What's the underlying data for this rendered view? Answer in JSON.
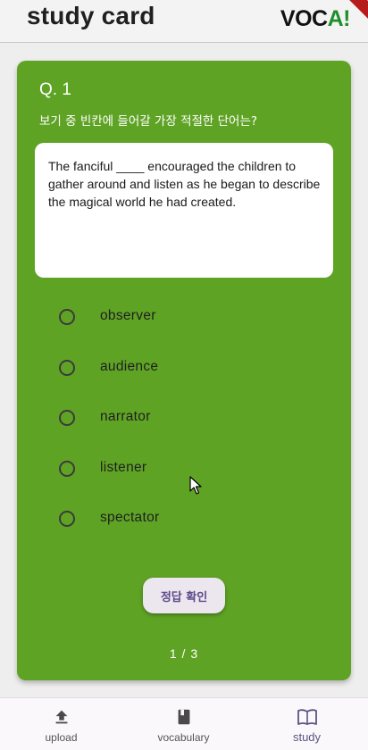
{
  "header": {
    "title": "study card",
    "logo_main": "VOC",
    "logo_accent": "A!"
  },
  "card": {
    "question_number": "Q. 1",
    "prompt": "보기 중 빈칸에 들어갈 가장 적절한 단어는?",
    "passage": "The fanciful ____ encouraged the children to gather around and listen as he began to describe the magical world he had created.",
    "options": [
      "observer",
      "audience",
      "narrator",
      "listener",
      "spectator"
    ],
    "check_button": "정답 확인",
    "pager": "1 / 3"
  },
  "nav": {
    "items": [
      {
        "label": "upload",
        "icon": "upload-icon"
      },
      {
        "label": "vocabulary",
        "icon": "book-icon"
      },
      {
        "label": "study",
        "icon": "open-book-icon"
      }
    ],
    "active": "study"
  },
  "colors": {
    "card": "#5fa325",
    "logo_accent": "#1f8f2b",
    "ribbon": "#b71c1c"
  }
}
